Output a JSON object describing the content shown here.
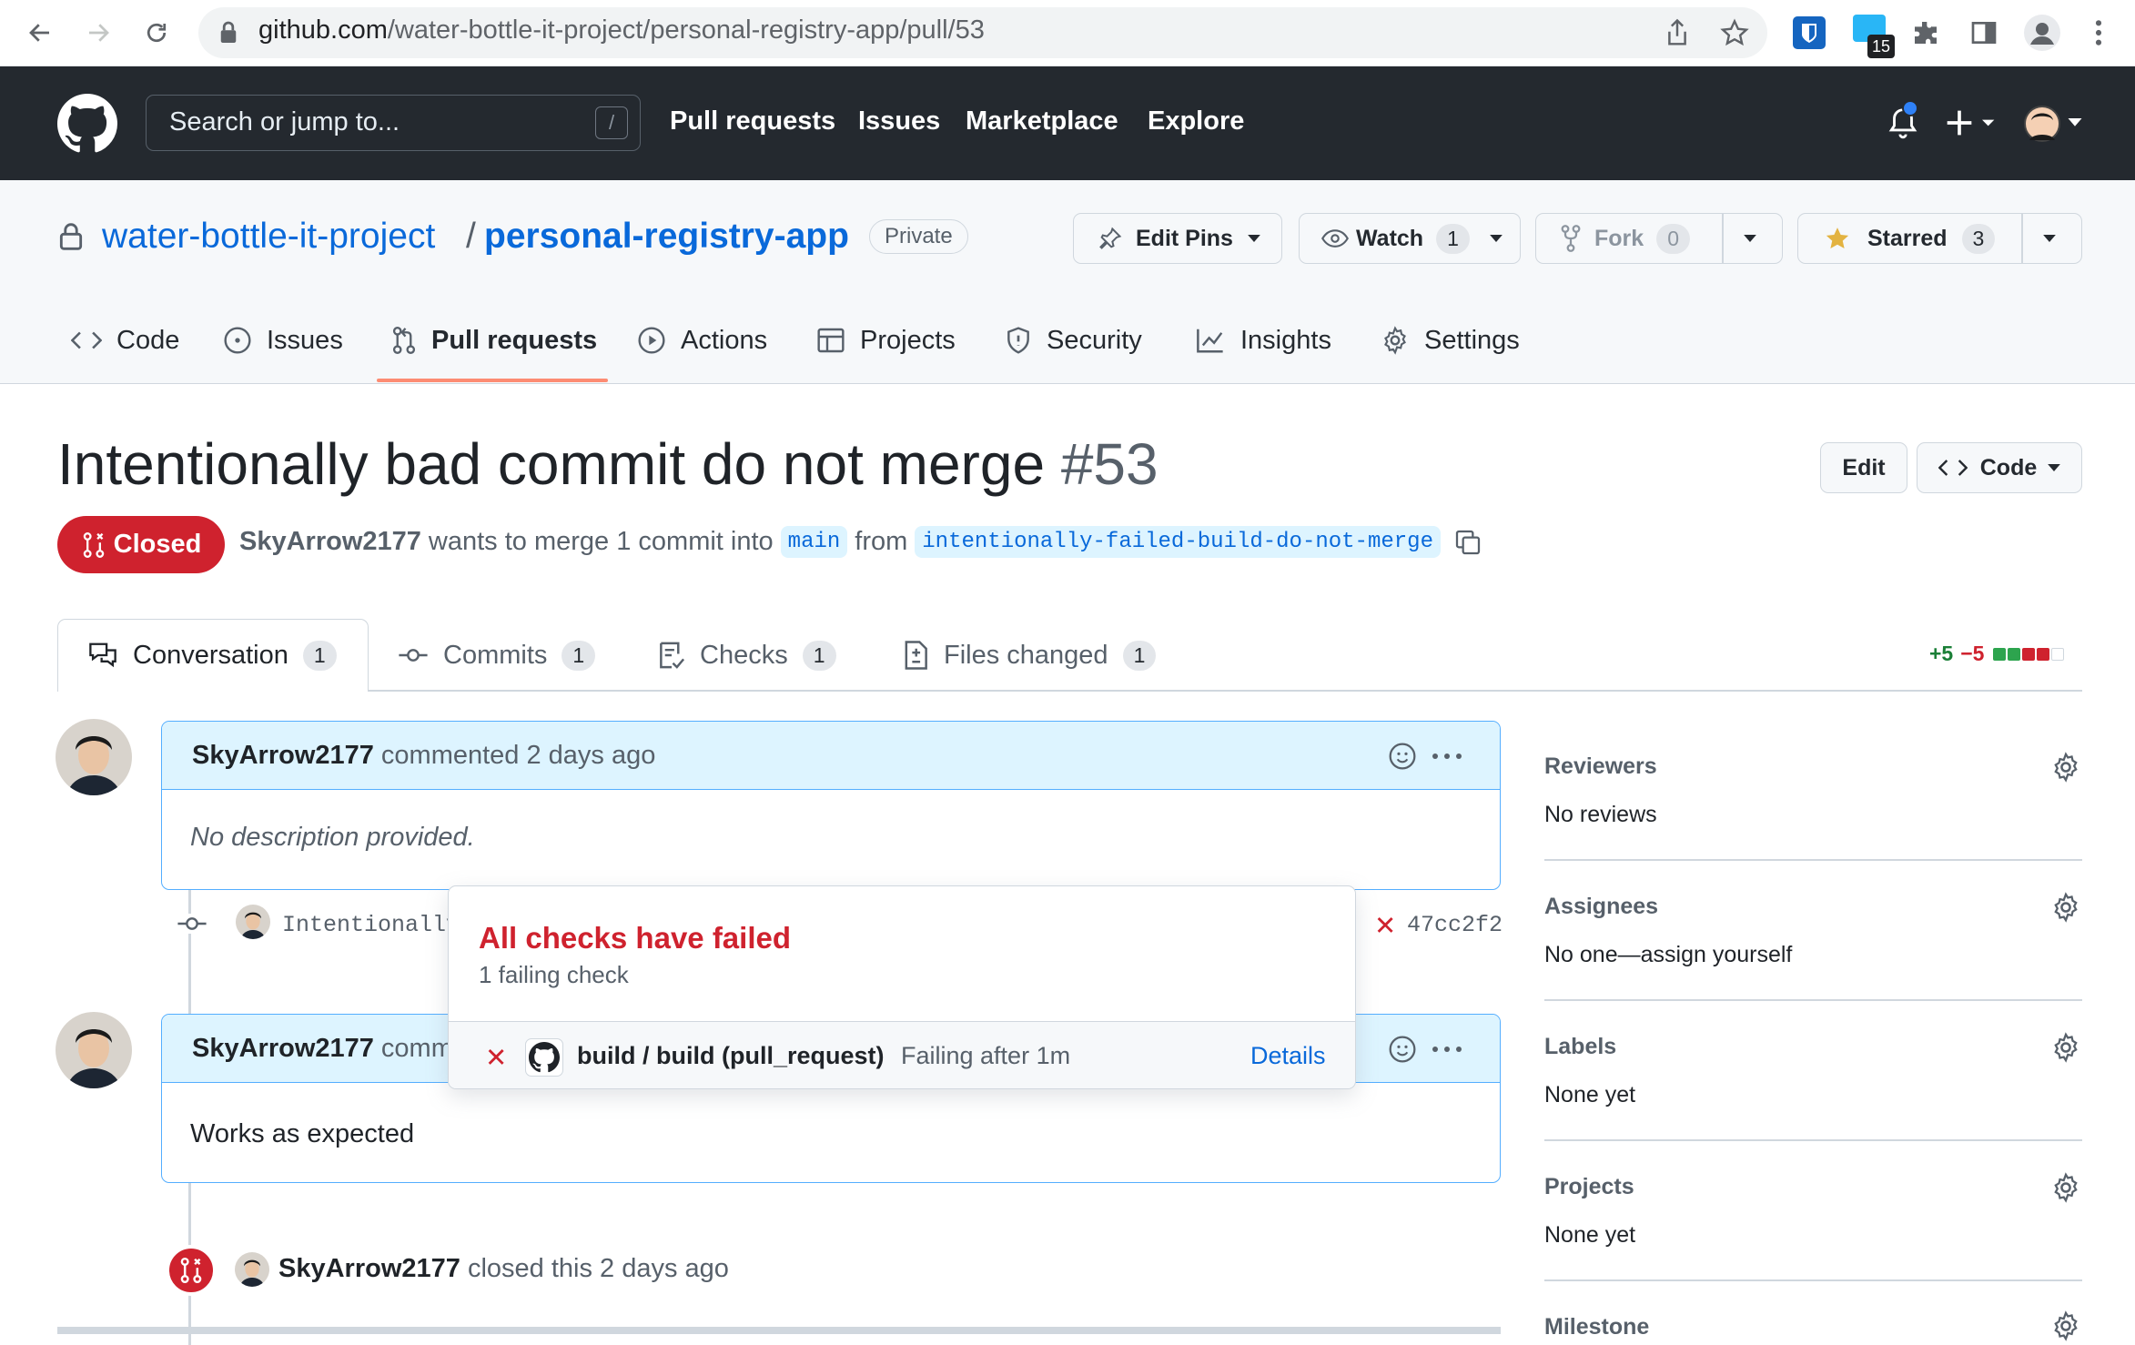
{
  "browser": {
    "url_host": "github.com",
    "url_path": "/water-bottle-it-project/personal-registry-app/pull/53",
    "extension_badge": "15"
  },
  "header": {
    "search_placeholder": "Search or jump to...",
    "search_key": "/",
    "nav": [
      "Pull requests",
      "Issues",
      "Marketplace",
      "Explore"
    ]
  },
  "repo": {
    "owner": "water-bottle-it-project",
    "separator": "/",
    "name": "personal-registry-app",
    "visibility": "Private",
    "edit_pins_label": "Edit Pins",
    "watch_label": "Watch",
    "watch_count": "1",
    "fork_label": "Fork",
    "fork_count": "0",
    "star_label": "Starred",
    "star_count": "3",
    "tabs": [
      "Code",
      "Issues",
      "Pull requests",
      "Actions",
      "Projects",
      "Security",
      "Insights",
      "Settings"
    ],
    "active_tab": "Pull requests"
  },
  "pr": {
    "title": "Intentionally bad commit do not merge",
    "number": "#53",
    "edit_label": "Edit",
    "code_label": "Code",
    "state": "Closed",
    "author": "SkyArrow2177",
    "meta_text": "wants to merge 1 commit into",
    "base_branch": "main",
    "from_text": "from",
    "head_branch": "intentionally-failed-build-do-not-merge",
    "tabs": [
      {
        "label": "Conversation",
        "count": "1"
      },
      {
        "label": "Commits",
        "count": "1"
      },
      {
        "label": "Checks",
        "count": "1"
      },
      {
        "label": "Files changed",
        "count": "1"
      }
    ],
    "additions": "+5",
    "deletions": "−5"
  },
  "timeline": {
    "comment1": {
      "author": "SkyArrow2177",
      "action": "commented 2 days ago",
      "body": "No description provided."
    },
    "commit": {
      "message": "Intentionally",
      "status": "✕",
      "sha": "47cc2f2"
    },
    "comment2": {
      "author": "SkyArrow2177",
      "action": "comm",
      "body": "Works as expected"
    },
    "closed_event": {
      "author": "SkyArrow2177",
      "text": "closed this 2 days ago"
    }
  },
  "checks_popover": {
    "title": "All checks have failed",
    "subtitle": "1 failing check",
    "check_name": "build / build (pull_request)",
    "check_status": "Failing after 1m",
    "details_label": "Details",
    "status_icon": "✕"
  },
  "sidebar": {
    "reviewers_label": "Reviewers",
    "reviewers_value": "No reviews",
    "assignees_label": "Assignees",
    "assignees_value": "No one—assign yourself",
    "labels_label": "Labels",
    "labels_value": "None yet",
    "projects_label": "Projects",
    "projects_value": "None yet",
    "milestone_label": "Milestone"
  },
  "colors": {
    "accent": "#0969da",
    "danger": "#cf222e",
    "success": "#1a7f37",
    "header_bg": "#24292f",
    "comment_header_bg": "#ddf4ff"
  }
}
